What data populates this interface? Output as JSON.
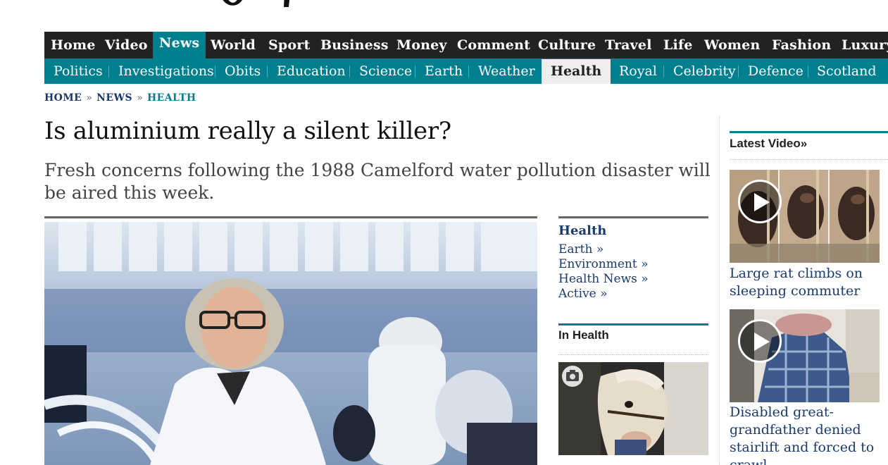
{
  "nav_primary": [
    {
      "label": "Home"
    },
    {
      "label": "Video"
    },
    {
      "label": "News",
      "active": true
    },
    {
      "label": "World"
    },
    {
      "label": "Sport"
    },
    {
      "label": "Business"
    },
    {
      "label": "Money"
    },
    {
      "label": "Comment"
    },
    {
      "label": "Culture"
    },
    {
      "label": "Travel"
    },
    {
      "label": "Life"
    },
    {
      "label": "Women"
    },
    {
      "label": "Fashion"
    },
    {
      "label": "Luxury"
    }
  ],
  "nav_secondary": [
    {
      "label": "Politics"
    },
    {
      "label": "Investigations"
    },
    {
      "label": "Obits"
    },
    {
      "label": "Education"
    },
    {
      "label": "Science"
    },
    {
      "label": "Earth"
    },
    {
      "label": "Weather"
    },
    {
      "label": "Health",
      "active": true
    },
    {
      "label": "Royal"
    },
    {
      "label": "Celebrity"
    },
    {
      "label": "Defence"
    },
    {
      "label": "Scotland"
    }
  ],
  "breadcrumb": {
    "home": "HOME",
    "news": "NEWS",
    "current": "HEALTH",
    "separator": "»"
  },
  "article": {
    "headline": "Is aluminium really a silent killer?",
    "standfirst": "Fresh concerns following the 1988 Camelford water pollution disaster will be aired this week."
  },
  "related": {
    "title": "Health",
    "links": [
      "Earth »",
      "Environment »",
      "Health News »",
      "Active »"
    ]
  },
  "in_health": {
    "title": "In Health",
    "camera_icon": "camera-icon"
  },
  "latest_video": {
    "title": "Latest Video»",
    "items": [
      {
        "caption": "Large rat climbs on sleeping commuter",
        "icon": "play-icon"
      },
      {
        "caption": "Disabled great-grandfather denied stairlift and forced to crawl",
        "icon": "play-icon"
      }
    ]
  },
  "colors": {
    "nav_dark": "#222222",
    "teal": "#00808f",
    "link_blue": "#1a3a6e"
  }
}
